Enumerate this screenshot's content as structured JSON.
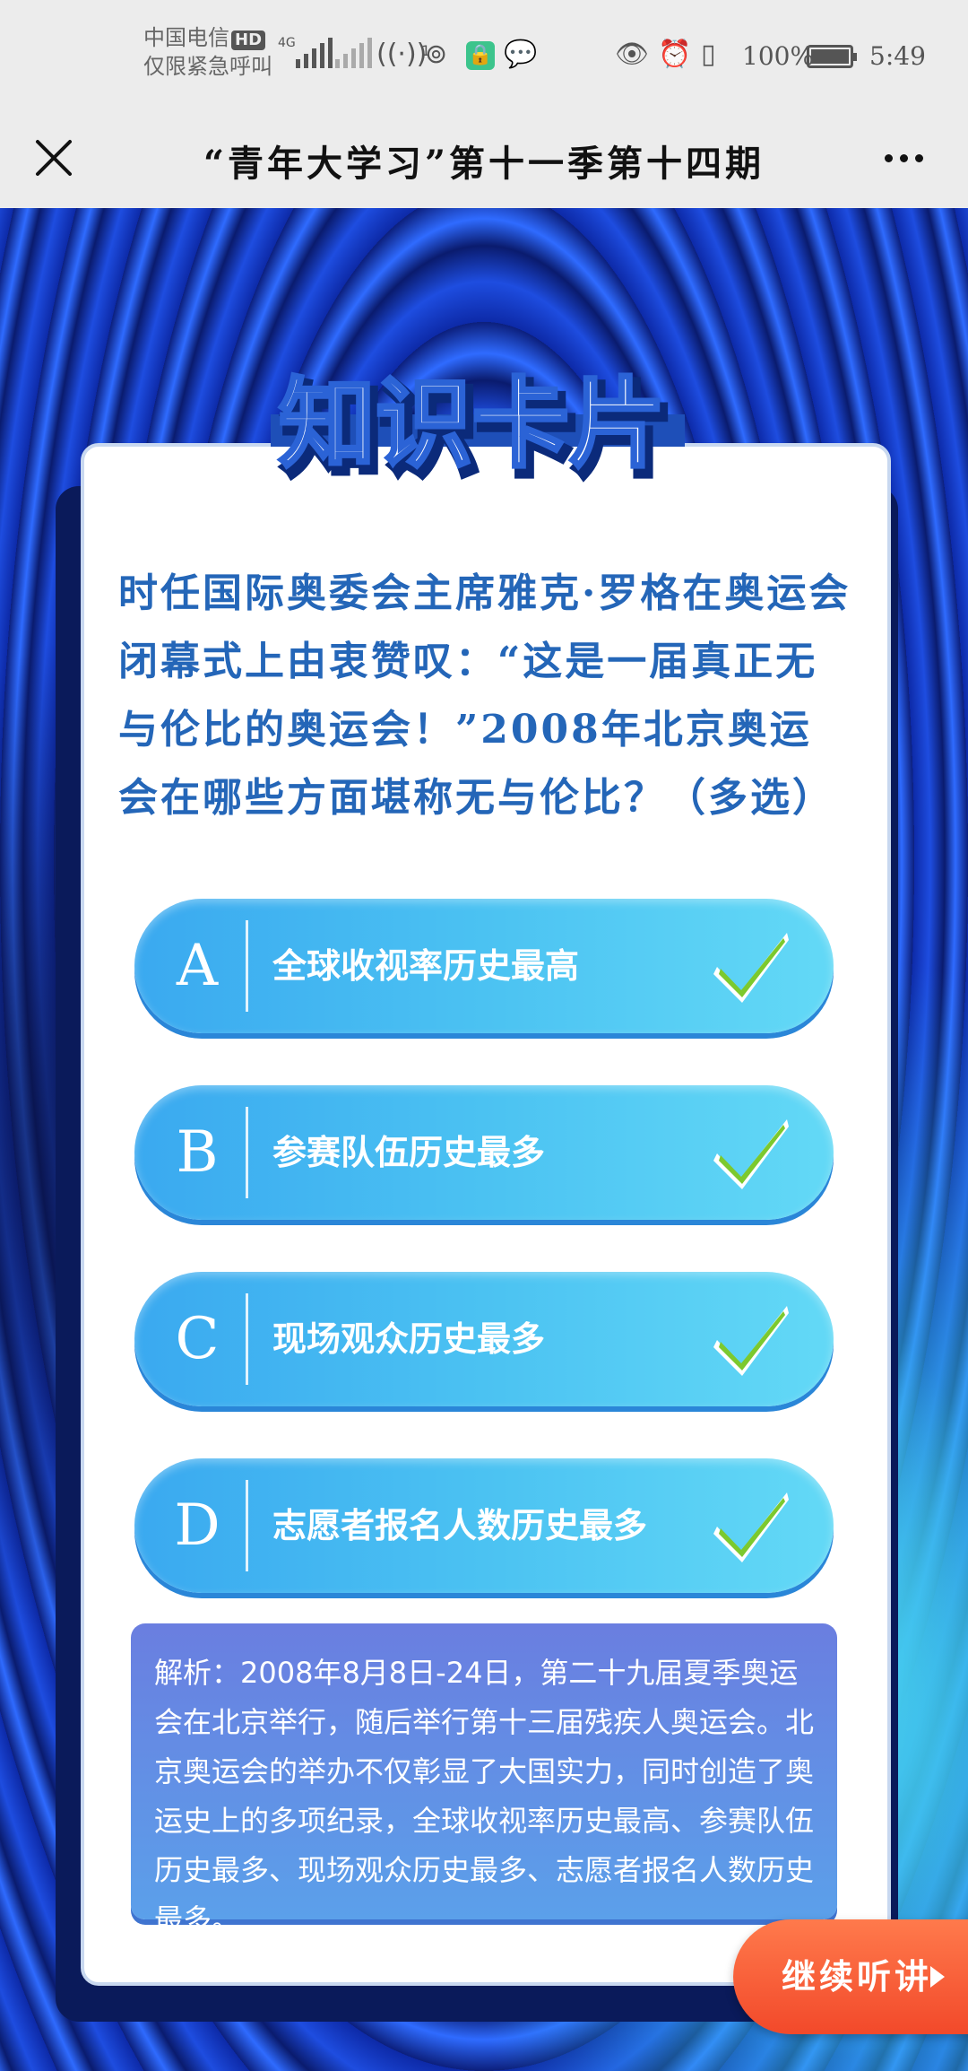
{
  "status_bar": {
    "carrier_line1": "中国电信",
    "carrier_line2": "仅限紧急呼叫",
    "hd": "HD",
    "network": "4G",
    "hotspot_count": "1",
    "battery_percent": "100%",
    "time": "5:49"
  },
  "title_bar": {
    "title": "“青年大学习”第十一季第十四期",
    "close_icon": "close-icon",
    "more_icon": "more-icon"
  },
  "banner": {
    "text": "知识卡片"
  },
  "question": "时任国际奥委会主席雅克·罗格在奥运会闭幕式上由衷赞叹：“这是一届真正无与伦比的奥运会！”2008年北京奥运会在哪些方面堪称无与伦比？（多选）",
  "options": [
    {
      "letter": "A",
      "text": "全球收视率历史最高"
    },
    {
      "letter": "B",
      "text": "参赛队伍历史最多"
    },
    {
      "letter": "C",
      "text": "现场观众历史最多"
    },
    {
      "letter": "D",
      "text": "志愿者报名人数历史最多"
    }
  ],
  "analysis": "解析：2008年8月8日-24日，第二十九届夏季奥运会在北京举行，随后举行第十三届残疾人奥运会。北京奥运会的举办不仅彰显了大国实力，同时创造了奥运史上的多项纪录，全球收视率历史最高、参赛队伍历史最多、现场观众历史最多、志愿者报名人数历史最多。",
  "continue_button": "继续听讲",
  "colors": {
    "question": "#2466b8",
    "option_start": "#3aa9f0",
    "option_end": "#63d9f6",
    "check": "#7cc92e",
    "continue": "#f2492a"
  }
}
